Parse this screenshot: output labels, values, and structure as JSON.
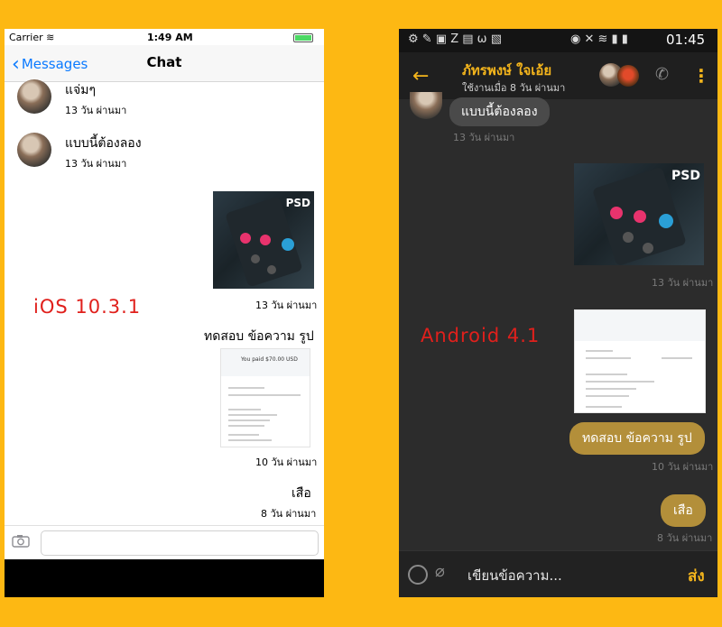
{
  "labels": {
    "ios": "iOS  10.3.1",
    "android": "Android  4.1"
  },
  "ios": {
    "status": {
      "carrier": "Carrier",
      "time": "1:49 AM"
    },
    "nav": {
      "back": "Messages",
      "title": "Chat"
    },
    "messages": [
      {
        "text": "แจ่มๆ",
        "time": "13 วัน ผ่านมา"
      },
      {
        "text": "แบบนี้ต้องลอง",
        "time": "13 วัน ผ่านมา"
      },
      {
        "image": "PSD",
        "time": "13 วัน ผ่านมา"
      },
      {
        "text": "ทดสอบ ข้อความ รูป",
        "receipt_title": "You paid $70.00 USD",
        "time": "10 วัน ผ่านมา"
      },
      {
        "text": "เสือ",
        "time": "8 วัน ผ่านมา"
      }
    ]
  },
  "android": {
    "status": {
      "time": "01:45"
    },
    "header": {
      "name": "ภัทรพงษ์ ใจเอ้ย",
      "status": "ใช้งานเมื่อ 8 วัน ผ่านมา"
    },
    "messages": [
      {
        "text": "แบบนี้ต้องลอง",
        "time": "13 วัน ผ่านมา"
      },
      {
        "image": "PSD",
        "time": "13 วัน ผ่านมา"
      },
      {
        "text": "ทดสอบ ข้อความ รูป",
        "time": "10 วัน ผ่านมา"
      },
      {
        "text": "เสือ",
        "time": "8 วัน ผ่านมา"
      }
    ],
    "composer": {
      "placeholder": "เขียนข้อความ...",
      "send": "ส่ง"
    }
  },
  "colors": {
    "background": "#FDB813",
    "ios_link": "#0A7AFF",
    "android_accent": "#F4B51C",
    "label_red": "#E0201C"
  }
}
